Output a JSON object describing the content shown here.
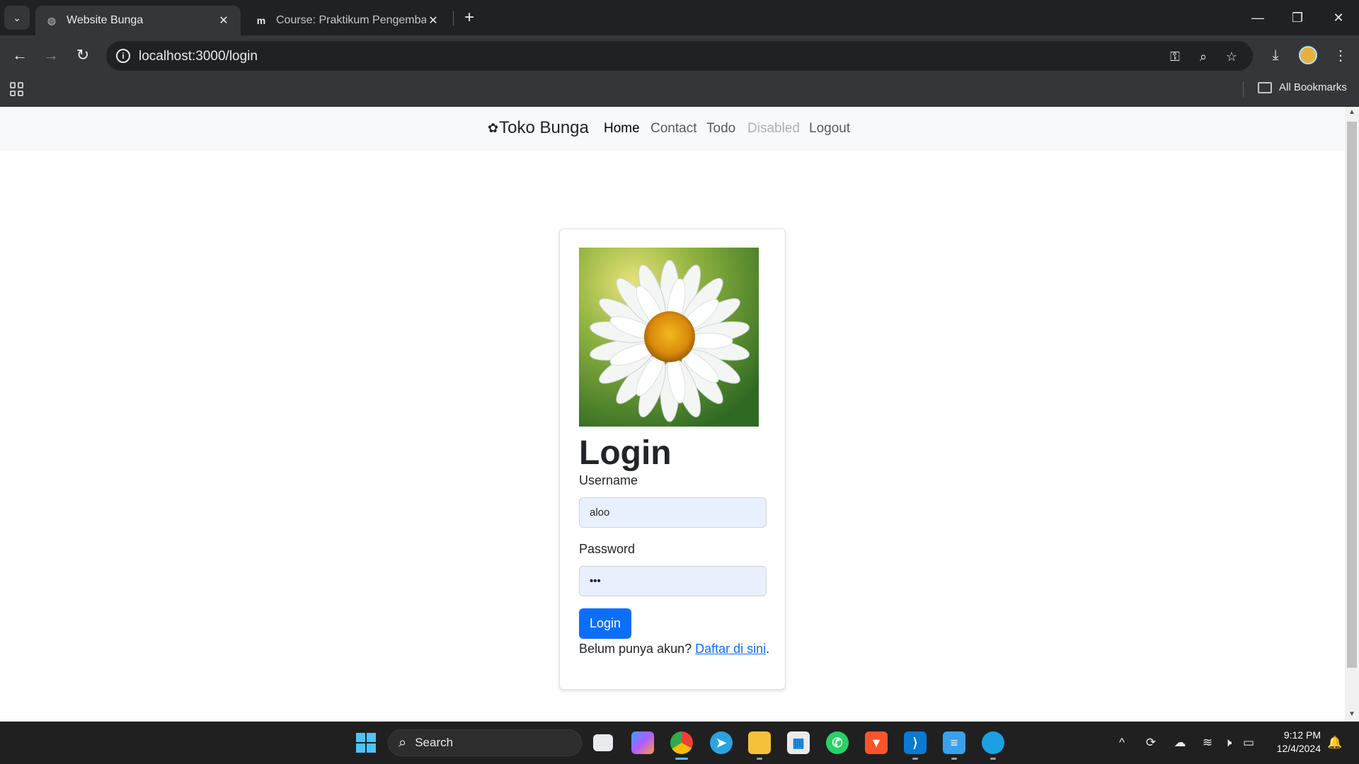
{
  "browser": {
    "tabs": [
      {
        "title": "Website Bunga",
        "active": true
      },
      {
        "title": "Course: Praktikum Pengembang",
        "active": false
      }
    ],
    "url": "localhost:3000/login",
    "bookmarks_label": "All Bookmarks"
  },
  "navbar": {
    "brand": "Toko Bunga",
    "links": [
      {
        "label": "Home",
        "state": "active"
      },
      {
        "label": "Contact",
        "state": "normal"
      },
      {
        "label": "Todo",
        "state": "normal"
      },
      {
        "label": "Disabled",
        "state": "disabled"
      },
      {
        "label": "Logout",
        "state": "normal"
      }
    ]
  },
  "login": {
    "title": "Login",
    "username_label": "Username",
    "username_value": "aloo",
    "password_label": "Password",
    "password_value": "•••",
    "button": "Login",
    "signup_text": "Belum punya akun?",
    "signup_link": "Daftar di sini",
    "signup_end": "."
  },
  "taskbar": {
    "search": "Search",
    "time": "9:12 PM",
    "date": "12/4/2024"
  },
  "colors": {
    "primary": "#0d6efd",
    "navbar_bg": "#f8f9fa",
    "browser_dark": "#202124"
  }
}
